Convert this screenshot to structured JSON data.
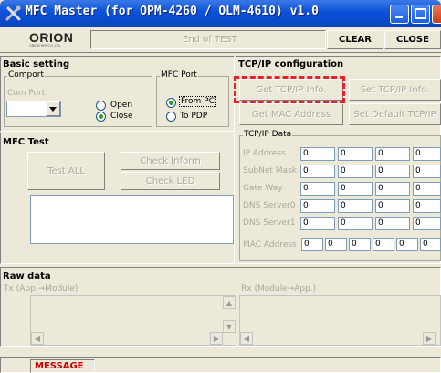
{
  "window": {
    "title": "MFC Master (for OPM-4260 / OLM-4610) v1.0",
    "icon": "tools-icon"
  },
  "header": {
    "logo_text": "ORION",
    "logo_sub": "ORION RFP CO.,LTD.",
    "status_text": "End of TEST",
    "clear_label": "CLEAR",
    "close_label": "CLOSE"
  },
  "basic_setting": {
    "title": "Basic setting",
    "comport_group": "Comport",
    "com_port_label": "Com Port",
    "com_port_value": "",
    "open_label": "Open",
    "close_label": "Close",
    "close_selected": true,
    "mfc_port_group": "MFC Port",
    "from_pc_label": "From PC",
    "to_pdp_label": "To PDP",
    "from_pc_selected": true
  },
  "mfc_test": {
    "title": "MFC Test",
    "test_all_label": "Test ALL",
    "check_inform_label": "Check Inform",
    "check_led_label": "Check LED"
  },
  "tcpip": {
    "title": "TCP/IP configuration",
    "get_info_label": "Get TCP/IP Info.",
    "set_info_label": "Set TCP/IP Info.",
    "get_mac_label": "Get MAC Address",
    "set_default_label": "Set Default TCP/IP",
    "data_group": "TCP/IP Data",
    "rows": [
      {
        "label": "IP Address",
        "values": [
          "0",
          "0",
          "0",
          "0"
        ]
      },
      {
        "label": "SubNet Mask",
        "values": [
          "0",
          "0",
          "0",
          "0"
        ]
      },
      {
        "label": "Gate Way",
        "values": [
          "0",
          "0",
          "0",
          "0"
        ]
      },
      {
        "label": "DNS Server0",
        "values": [
          "0",
          "0",
          "0",
          "0"
        ]
      },
      {
        "label": "DNS Server1",
        "values": [
          "0",
          "0",
          "0",
          "0"
        ]
      }
    ],
    "mac_label": "MAC Address",
    "mac_values": [
      "0",
      "0",
      "0",
      "0",
      "0",
      "0"
    ]
  },
  "raw_data": {
    "title": "Raw data",
    "tx_label": "Tx (App.→Module)",
    "rx_label": "Rx (Module→App.)"
  },
  "statusbar": {
    "message_label": "MESSAGE"
  },
  "colors": {
    "titlebar": "#0a50d8",
    "message": "#cc0000",
    "highlight_dash": "#e8202a"
  }
}
